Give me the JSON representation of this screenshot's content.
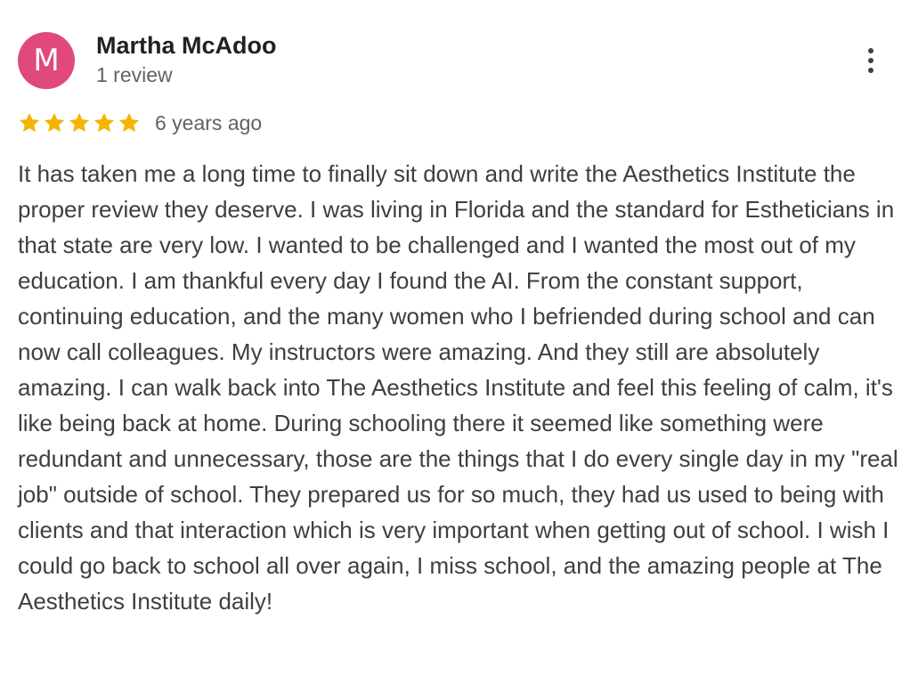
{
  "review": {
    "avatar_initial": "M",
    "author_name": "Martha McAdoo",
    "review_count": "1 review",
    "rating": 5,
    "max_rating": 5,
    "date": "6 years ago",
    "text": "It has taken me a long time to finally sit down and write the Aesthetics Institute the proper review they deserve. I was living in Florida and the standard for Estheticians in that state are very low. I wanted to be challenged and I wanted the most out of my education. I am thankful every day I found the AI. From the constant support, continuing education, and the many women who I befriended during school and can now call colleagues. My instructors were amazing. And they still are absolutely amazing. I can walk back into The Aesthetics Institute and feel this feeling of calm, it's like being back at home. During schooling there it seemed like something were redundant and unnecessary, those are the things that I do every single day in my \"real job\" outside of school. They prepared us for so much, they had us used to being with clients and that interaction which is very important when getting out of school. I wish I could go back to school all over again, I miss school, and the amazing people at The Aesthetics Institute daily!"
  },
  "icons": {
    "more": "more-vert-icon",
    "star": "star-icon"
  },
  "colors": {
    "avatar_bg": "#e0497b",
    "star": "#f4b400",
    "name": "#202124",
    "meta": "#5f6368",
    "body": "#3c4043"
  }
}
